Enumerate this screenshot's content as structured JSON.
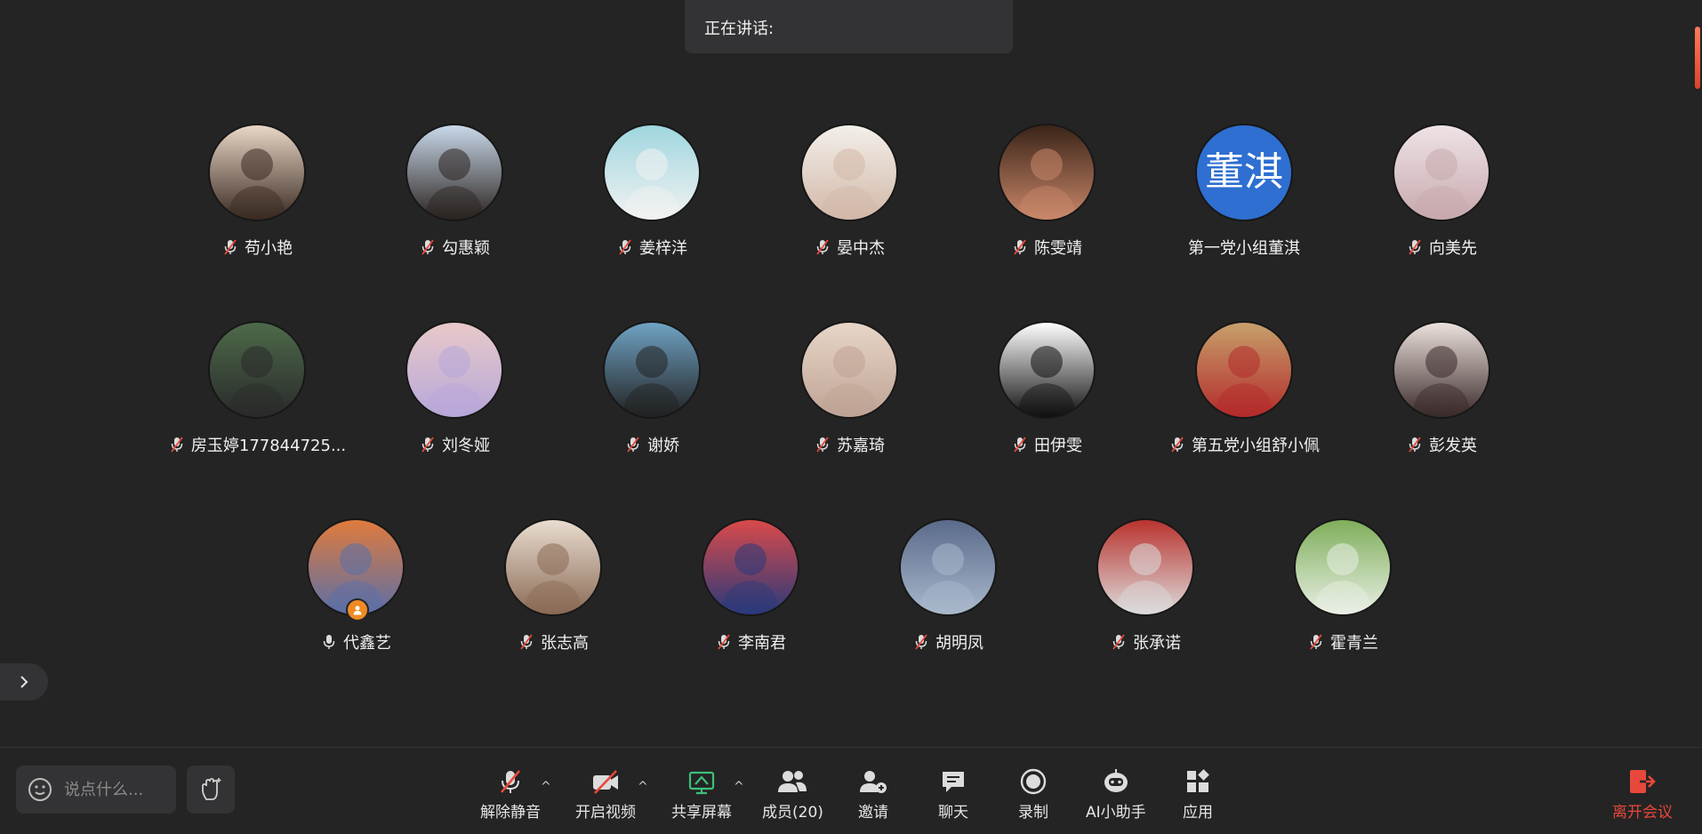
{
  "banner": {
    "label": "正在讲话:"
  },
  "participants": [
    {
      "name": "苟小艳",
      "mic": "muted"
    },
    {
      "name": "勾惠颖",
      "mic": "muted"
    },
    {
      "name": "姜梓洋",
      "mic": "muted"
    },
    {
      "name": "晏中杰",
      "mic": "muted"
    },
    {
      "name": "陈雯靖",
      "mic": "muted"
    },
    {
      "name": "第一党小组董淇",
      "mic": "none",
      "initials": "董淇"
    },
    {
      "name": "向美先",
      "mic": "muted"
    },
    {
      "name": "房玉婷177844725...",
      "mic": "muted"
    },
    {
      "name": "刘冬娅",
      "mic": "muted"
    },
    {
      "name": "谢娇",
      "mic": "muted"
    },
    {
      "name": "苏嘉琦",
      "mic": "muted"
    },
    {
      "name": "田伊雯",
      "mic": "muted"
    },
    {
      "name": "第五党小组舒小佩",
      "mic": "muted"
    },
    {
      "name": "彭发英",
      "mic": "muted"
    },
    {
      "name": "代鑫艺",
      "mic": "on",
      "host": true
    },
    {
      "name": "张志高",
      "mic": "muted"
    },
    {
      "name": "李南君",
      "mic": "muted"
    },
    {
      "name": "胡明凤",
      "mic": "muted"
    },
    {
      "name": "张承诺",
      "mic": "muted"
    },
    {
      "name": "霍青兰",
      "mic": "muted"
    }
  ],
  "toolbar": {
    "chat_placeholder": "说点什么...",
    "unmute": "解除静音",
    "start_video": "开启视频",
    "share_screen": "共享屏幕",
    "members": "成员(20)",
    "invite": "邀请",
    "chat": "聊天",
    "record": "录制",
    "ai_assistant": "AI小助手",
    "apps": "应用",
    "leave": "离开会议"
  },
  "colors": {
    "background": "#242424",
    "leave": "#e8483b",
    "muted_slash": "#e8483b",
    "host_badge": "#f08a24",
    "initials_bg": "#2e6fd1"
  }
}
